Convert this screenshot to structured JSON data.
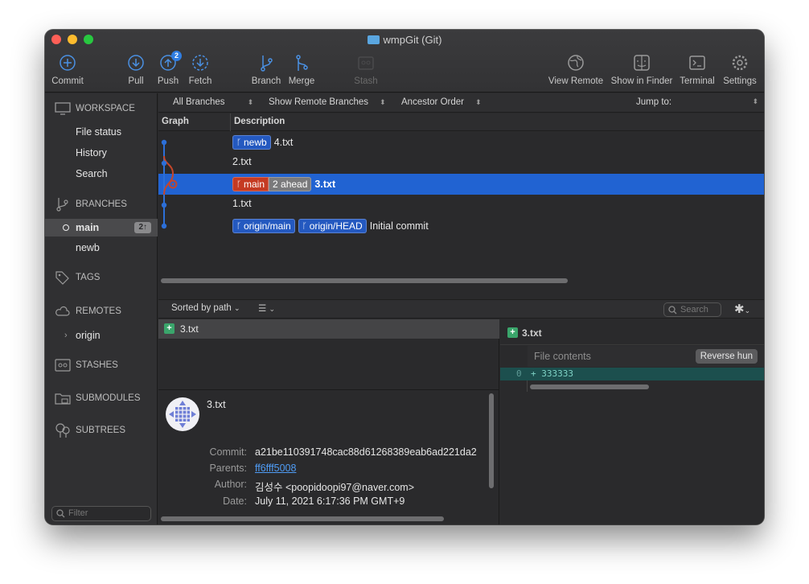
{
  "window": {
    "title": "wmpGit (Git)"
  },
  "toolbar": {
    "commit": "Commit",
    "pull": "Pull",
    "push": "Push",
    "push_badge": "2",
    "fetch": "Fetch",
    "branch": "Branch",
    "merge": "Merge",
    "stash": "Stash",
    "view_remote": "View Remote",
    "show_in_finder": "Show in Finder",
    "terminal": "Terminal",
    "settings": "Settings"
  },
  "sidebar": {
    "workspace": "WORKSPACE",
    "file_status": "File status",
    "history": "History",
    "search": "Search",
    "branches": "BRANCHES",
    "branch_main": "main",
    "branch_main_count": "2↑",
    "branch_newb": "newb",
    "tags": "TAGS",
    "remotes": "REMOTES",
    "remote_origin": "origin",
    "stashes": "STASHES",
    "submodules": "SUBMODULES",
    "subtrees": "SUBTREES",
    "filter_placeholder": "Filter"
  },
  "filterbar": {
    "branches": "All Branches",
    "remote": "Show Remote Branches",
    "order": "Ancestor Order",
    "jump": "Jump to:"
  },
  "columns": {
    "graph": "Graph",
    "description": "Description"
  },
  "commits": [
    {
      "tags": [
        "newb"
      ],
      "message": "4.txt"
    },
    {
      "tags": [],
      "message": "2.txt"
    },
    {
      "tags": [
        "main"
      ],
      "ahead": "2 ahead",
      "message": "3.txt",
      "selected": true
    },
    {
      "tags": [],
      "message": "1.txt"
    },
    {
      "tags": [
        "origin/main",
        "origin/HEAD"
      ],
      "message": "Initial commit"
    }
  ],
  "lower": {
    "sort": "Sorted by path",
    "search_placeholder": "Search"
  },
  "files": [
    {
      "name": "3.txt"
    }
  ],
  "details": {
    "title": "3.txt",
    "commit_label": "Commit:",
    "commit": "a21be110391748cac88d61268389eab6ad221da2",
    "parents_label": "Parents:",
    "parents": "ff6fff5008",
    "author_label": "Author:",
    "author": "김성수 <poopidoopi97@naver.com>",
    "date_label": "Date:",
    "date": "July 11, 2021 6:17:36 PM GMT+9"
  },
  "diff": {
    "file": "3.txt",
    "sub": "File contents",
    "reverse": "Reverse hun",
    "line_no": "0",
    "line": "+ 333333"
  },
  "colors": {
    "accent": "#2163d2",
    "red_tag": "#c53a22",
    "blue_tag": "#2459c0",
    "added": "#3aa56b"
  }
}
